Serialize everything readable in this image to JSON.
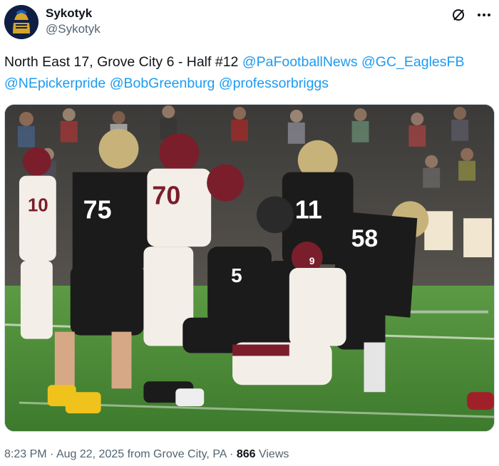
{
  "author": {
    "display_name": "Sykotyk",
    "handle": "@Sykotyk",
    "avatar_icon": "knight-helmet-avatar"
  },
  "actions": {
    "grok_icon": "grok-slash-circle-icon",
    "more_icon": "more-dots-icon"
  },
  "tweet": {
    "text": "North East 17, Grove City 6 - Half #12",
    "mentions": [
      "@PaFootballNews",
      "@GC_EaglesFB",
      "@NEpickerpride",
      "@BobGreenburg",
      "@professorbriggs"
    ]
  },
  "media": {
    "jersey_numbers": [
      "75",
      "70",
      "11",
      "58",
      "5",
      "9"
    ],
    "colors": {
      "home_jersey": "#1b1b1b",
      "away_jersey": "#f3efe8",
      "maroon": "#7a1e2b",
      "gold": "#c7b27a",
      "field": "#4b8a37"
    }
  },
  "meta": {
    "time": "8:23 PM",
    "separator": "·",
    "date": "Aug 22, 2025",
    "location": "from Grove City, PA",
    "views_count": "866",
    "views_label": "Views"
  }
}
